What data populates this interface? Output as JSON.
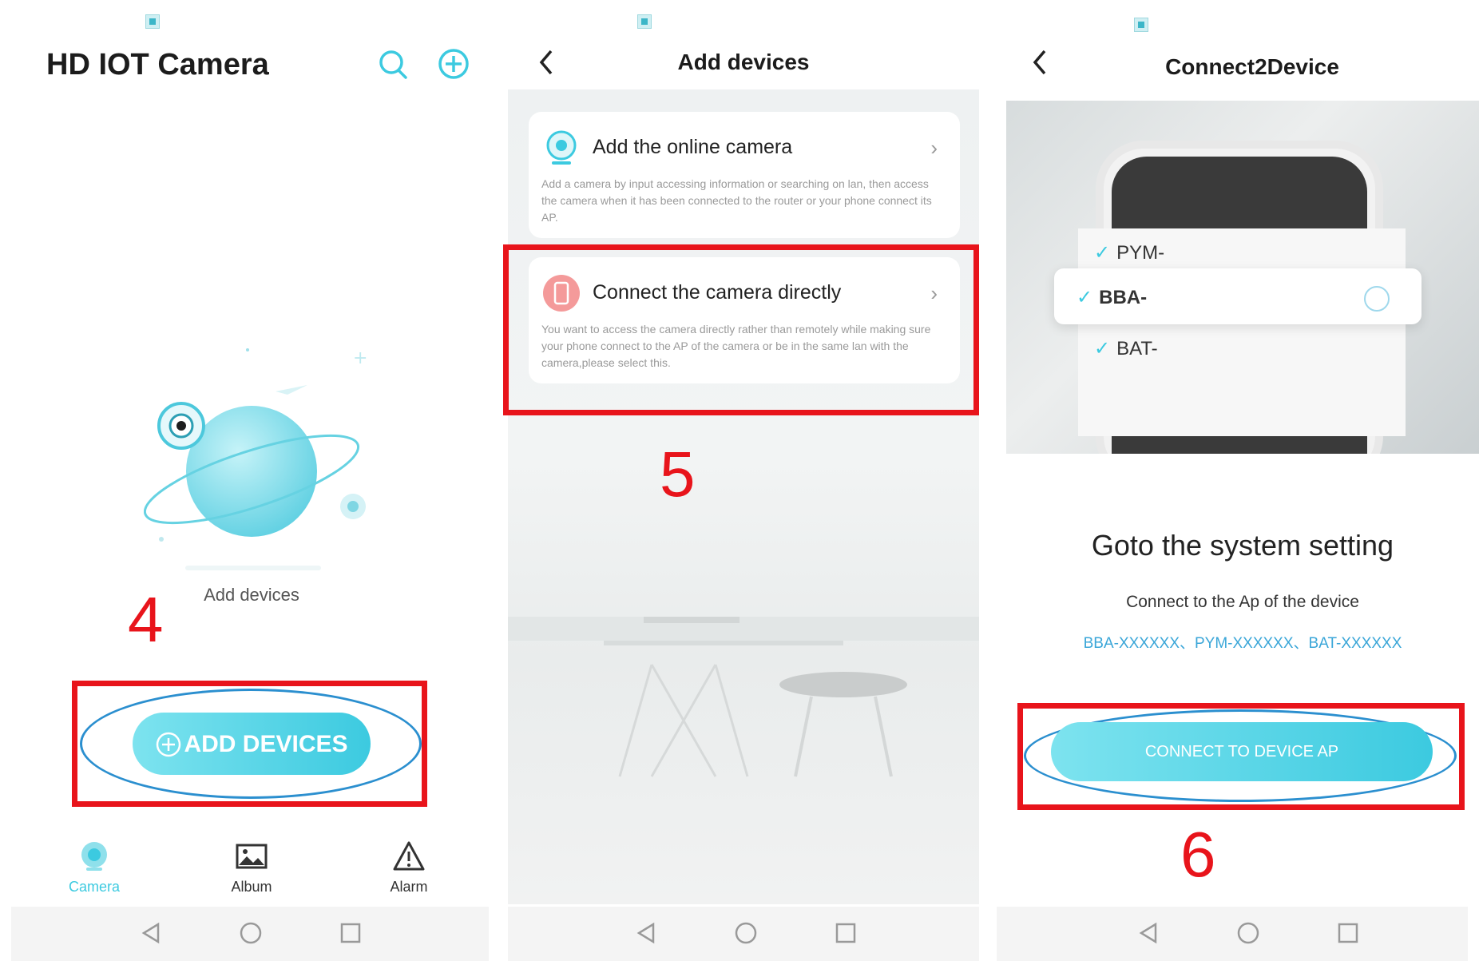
{
  "panel1": {
    "title": "HD IOT Camera",
    "empty_label": "Add devices",
    "add_button": "ADD DEVICES",
    "step": "4",
    "tabs": [
      {
        "label": "Camera",
        "icon": "camera-icon",
        "active": true
      },
      {
        "label": "Album",
        "icon": "album-icon",
        "active": false
      },
      {
        "label": "Alarm",
        "icon": "alarm-icon",
        "active": false
      }
    ]
  },
  "panel2": {
    "title": "Add devices",
    "option_online": {
      "title": "Add the online camera",
      "desc": "Add a camera by input accessing information or searching on lan, then access the camera when it has been connected to the router or your phone connect its AP."
    },
    "option_direct": {
      "title": "Connect the camera directly",
      "desc": "You want to access the camera directly rather than remotely while making sure your phone connect to the AP of the camera or be in the same lan with the camera,please select this."
    },
    "step": "5"
  },
  "panel3": {
    "title": "Connect2Device",
    "wifi_list": [
      "PYM-",
      "BBA-",
      "BAT-"
    ],
    "heading": "Goto the system setting",
    "subheading": "Connect to the Ap of the device",
    "ap_names": "BBA-XXXXXX、PYM-XXXXXX、BAT-XXXXXX",
    "button": "CONNECT TO DEVICE AP",
    "step": "6"
  },
  "colors": {
    "accent": "#3ccae0",
    "highlight": "#e8141b",
    "link": "#3aa6d8"
  }
}
